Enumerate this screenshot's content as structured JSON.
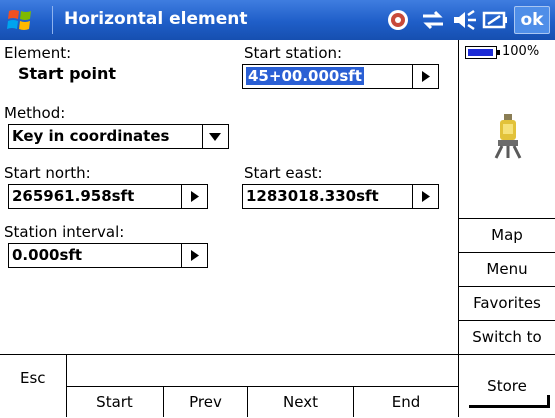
{
  "titlebar": {
    "title": "Horizontal element",
    "ok_label": "ok",
    "icons": [
      "windows-start-icon",
      "gps-status-icon",
      "connectivity-icon",
      "speaker-icon",
      "battery-status-icon"
    ]
  },
  "form": {
    "element_label": "Element:",
    "element_value": "Start point",
    "start_station_label": "Start station:",
    "start_station_value": "45+00.000sft",
    "method_label": "Method:",
    "method_value": "Key in coordinates",
    "start_north_label": "Start north:",
    "start_north_value": "265961.958sft",
    "start_east_label": "Start east:",
    "start_east_value": "1283018.330sft",
    "station_interval_label": "Station interval:",
    "station_interval_value": "0.000sft"
  },
  "sidebar": {
    "battery_percent": "100%",
    "buttons": [
      {
        "label": "Map"
      },
      {
        "label": "Menu"
      },
      {
        "label": "Favorites"
      },
      {
        "label": "Switch to"
      }
    ]
  },
  "bottom": {
    "esc_label": "Esc",
    "nav": [
      "Start",
      "Prev",
      "Next",
      "End"
    ],
    "store_label": "Store"
  },
  "colors": {
    "titlebar": "#1f5ec8",
    "selection": "#2a5fd4",
    "battery": "#1c2bd6"
  }
}
